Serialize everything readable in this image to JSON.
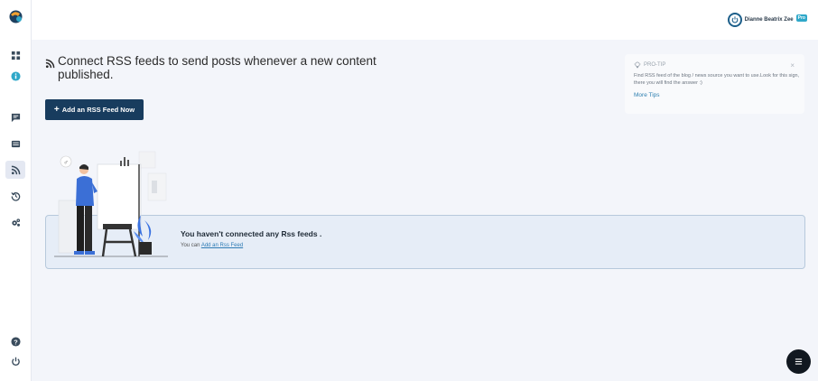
{
  "header": {
    "user_name": "Dianne Beatrix Zee",
    "badge": "Pro"
  },
  "page": {
    "title": "Connect RSS feeds to send posts whenever a new content published.",
    "add_button_label": "Add an RSS Feed Now"
  },
  "protip": {
    "heading": "PRO-TIP",
    "text": "Find RSS feed of the blog / news source you want to use.Look for this sign, there you will find the answer :)",
    "more_link": "More Tips",
    "close": "×"
  },
  "empty_state": {
    "title": "You haven't connected any Rss feeds .",
    "sub_prefix": "You can",
    "sub_link": "Add an Rss Feed"
  },
  "sidebar": {
    "items": [
      {
        "icon": "dashboard-icon"
      },
      {
        "icon": "info-icon"
      },
      {
        "icon": "chat-icon"
      },
      {
        "icon": "queue-icon"
      },
      {
        "icon": "rss-icon"
      },
      {
        "icon": "history-icon"
      },
      {
        "icon": "settings-icon"
      },
      {
        "icon": "help-icon"
      },
      {
        "icon": "power-icon"
      }
    ]
  },
  "colors": {
    "primary": "#183c5e",
    "accent": "#2fa8c9",
    "background": "#f3f5fa",
    "empty_box": "#e6edf7"
  }
}
